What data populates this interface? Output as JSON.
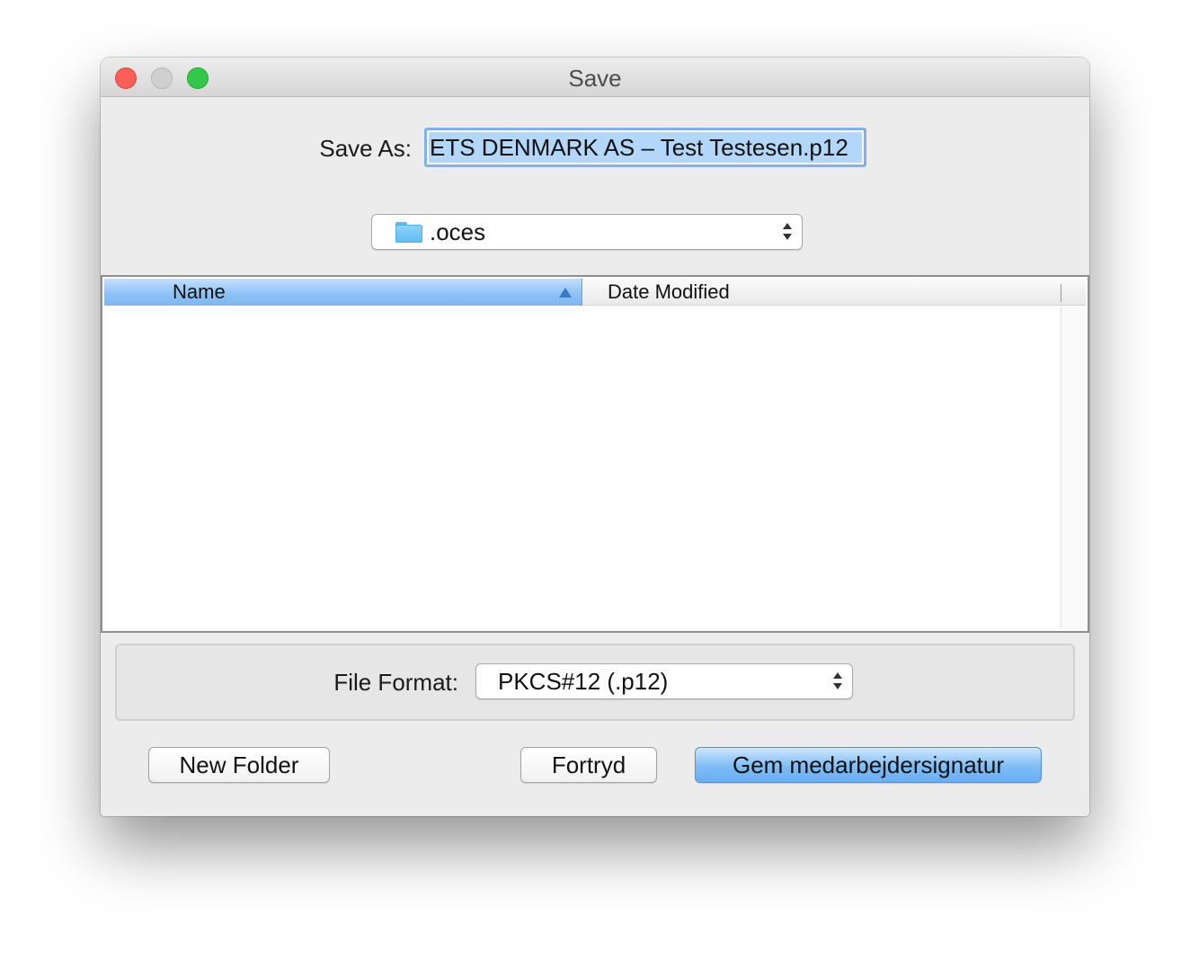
{
  "window": {
    "title": "Save"
  },
  "save_as": {
    "label": "Save As:",
    "value": "ETS DENMARK AS – Test Testesen.p12"
  },
  "location": {
    "folder": ".oces",
    "icon": "folder-icon"
  },
  "browser": {
    "columns": [
      {
        "label": "Name",
        "sorted": "ascending"
      },
      {
        "label": "Date Modified"
      }
    ],
    "rows": []
  },
  "file_format": {
    "label": "File Format:",
    "selected": "PKCS#12 (.p12)"
  },
  "buttons": {
    "new_folder": "New Folder",
    "cancel": "Fortryd",
    "save": "Gem medarbejdersignatur"
  },
  "colors": {
    "accent": "#7fb6f0",
    "close": "#fc5f57",
    "maximize": "#34c84a"
  }
}
